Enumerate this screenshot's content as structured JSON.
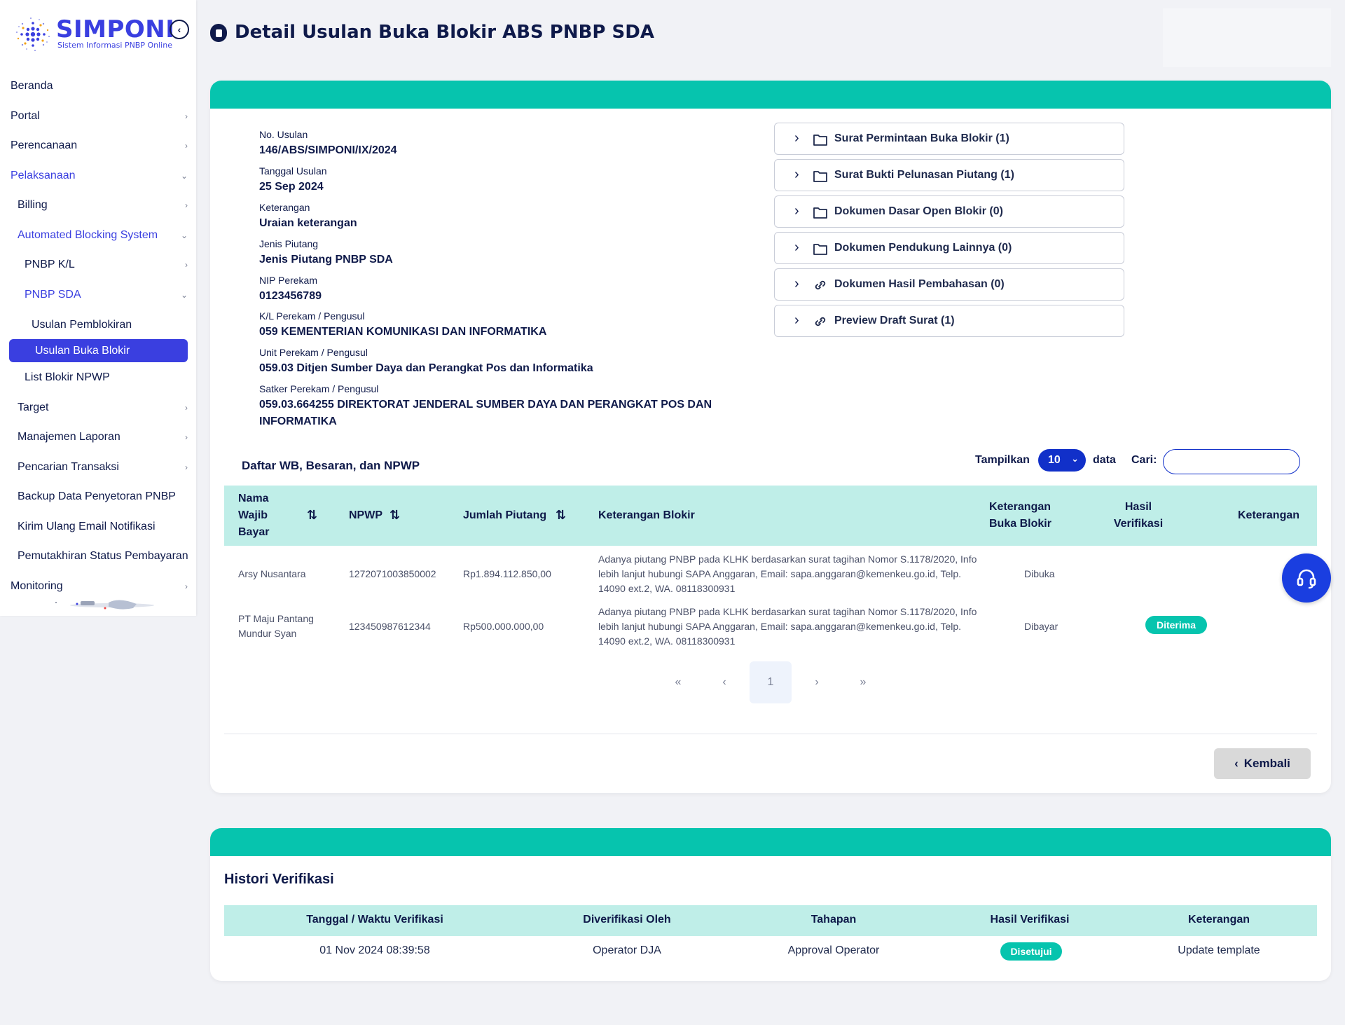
{
  "brand": {
    "name": "SIMPONI",
    "tagline": "Sistem Informasi PNBP Online",
    "color": "#3a3fe0"
  },
  "sidebar": {
    "items": [
      {
        "label": "Beranda"
      },
      {
        "label": "Portal"
      },
      {
        "label": "Perencanaan"
      },
      {
        "label": "Pelaksanaan"
      },
      {
        "label": "Billing"
      },
      {
        "label": "Automated Blocking System"
      },
      {
        "label": "PNBP K/L"
      },
      {
        "label": "PNBP SDA"
      },
      {
        "label": "Usulan Pemblokiran"
      },
      {
        "label": "Usulan Buka Blokir"
      },
      {
        "label": "List Blokir NPWP"
      },
      {
        "label": "Target"
      },
      {
        "label": "Manajemen Laporan"
      },
      {
        "label": "Pencarian Transaksi"
      },
      {
        "label": "Backup Data Penyetoran PNBP"
      },
      {
        "label": "Kirim Ulang Email Notifikasi"
      },
      {
        "label": "Pemutakhiran Status Pembayaran"
      },
      {
        "label": "Monitoring"
      }
    ],
    "selected_color": "#3a3fe0"
  },
  "page": {
    "title": "Detail Usulan Buka Blokir ABS PNBP SDA"
  },
  "detail": {
    "fields": [
      {
        "label": "No. Usulan",
        "value": "146/ABS/SIMPONI/IX/2024"
      },
      {
        "label": "Tanggal Usulan",
        "value": "25 Sep 2024"
      },
      {
        "label": "Keterangan",
        "value": "Uraian keterangan"
      },
      {
        "label": "Jenis Piutang",
        "value": "Jenis Piutang PNBP SDA"
      },
      {
        "label": "NIP Perekam",
        "value": "0123456789"
      },
      {
        "label": "K/L Perekam / Pengusul",
        "value": "059 KEMENTERIAN KOMUNIKASI DAN INFORMATIKA"
      },
      {
        "label": "Unit Perekam / Pengusul",
        "value": "059.03 Ditjen Sumber Daya dan Perangkat Pos dan Informatika"
      },
      {
        "label": "Satker Perekam / Pengusul",
        "value": "059.03.664255 DIREKTORAT JENDERAL SUMBER DAYA DAN PERANGKAT POS DAN INFORMATIKA"
      }
    ],
    "documents": [
      {
        "label": "Surat Permintaan Buka Blokir (1)",
        "icon": "folder-icon"
      },
      {
        "label": "Surat Bukti Pelunasan Piutang (1)",
        "icon": "folder-icon"
      },
      {
        "label": "Dokumen Dasar Open Blokir (0)",
        "icon": "folder-icon"
      },
      {
        "label": "Dokumen Pendukung Lainnya (0)",
        "icon": "folder-icon"
      },
      {
        "label": "Dokumen Hasil Pembahasan (0)",
        "icon": "link-icon"
      },
      {
        "label": "Preview Draft Surat (1)",
        "icon": "link-icon"
      }
    ]
  },
  "wb_table": {
    "title": "Daftar WB, Besaran, dan NPWP",
    "show_label": "Tampilkan",
    "show_value": "10",
    "show_suffix": "data",
    "search_label": "Cari:",
    "search_value": "",
    "columns": [
      "Nama Wajib Bayar",
      "NPWP",
      "Jumlah Piutang",
      "Keterangan Blokir",
      "Keterangan Buka Blokir",
      "Hasil Verifikasi",
      "Keterangan"
    ],
    "rows": [
      {
        "nama": "Arsy Nusantara",
        "npwp": "1272071003850002",
        "jumlah": "Rp1.894.112.850,00",
        "ket_blokir": "Adanya piutang PNBP pada KLHK berdasarkan surat tagihan Nomor S.1178/2020, Info lebih lanjut hubungi SAPA Anggaran, Email: sapa.anggaran@kemenkeu.go.id, Telp. 14090 ext.2, WA. 08118300931",
        "ket_buka": "Dibuka",
        "hasil": "",
        "keterangan": ""
      },
      {
        "nama": "PT Maju Pantang Mundur Syan",
        "npwp": "123450987612344",
        "jumlah": "Rp500.000.000,00",
        "ket_blokir": "Adanya piutang PNBP pada KLHK berdasarkan surat tagihan Nomor S.1178/2020, Info lebih lanjut hubungi SAPA Anggaran, Email: sapa.anggaran@kemenkeu.go.id, Telp. 14090 ext.2, WA. 08118300931",
        "ket_buka": "Dibayar",
        "hasil": "Diterima",
        "keterangan": ""
      }
    ],
    "pagination": {
      "first": "«",
      "prev": "‹",
      "current": "1",
      "next": "›",
      "last": "»"
    },
    "back_label": "Kembali"
  },
  "history": {
    "title": "Histori Verifikasi",
    "columns": [
      "Tanggal / Waktu Verifikasi",
      "Diverifikasi Oleh",
      "Tahapan",
      "Hasil Verifikasi",
      "Keterangan"
    ],
    "rows": [
      {
        "tanggal": "01 Nov 2024 08:39:58",
        "oleh": "Operator DJA",
        "tahapan": "Approval Operator",
        "hasil": "Disetujui",
        "keterangan": "Update template"
      }
    ]
  },
  "colors": {
    "accent_teal": "#06c4ae",
    "table_header": "#bfeee8",
    "primary_blue": "#1130c9",
    "navy_text": "#0f1a4a"
  },
  "help_icon": "headset-icon"
}
